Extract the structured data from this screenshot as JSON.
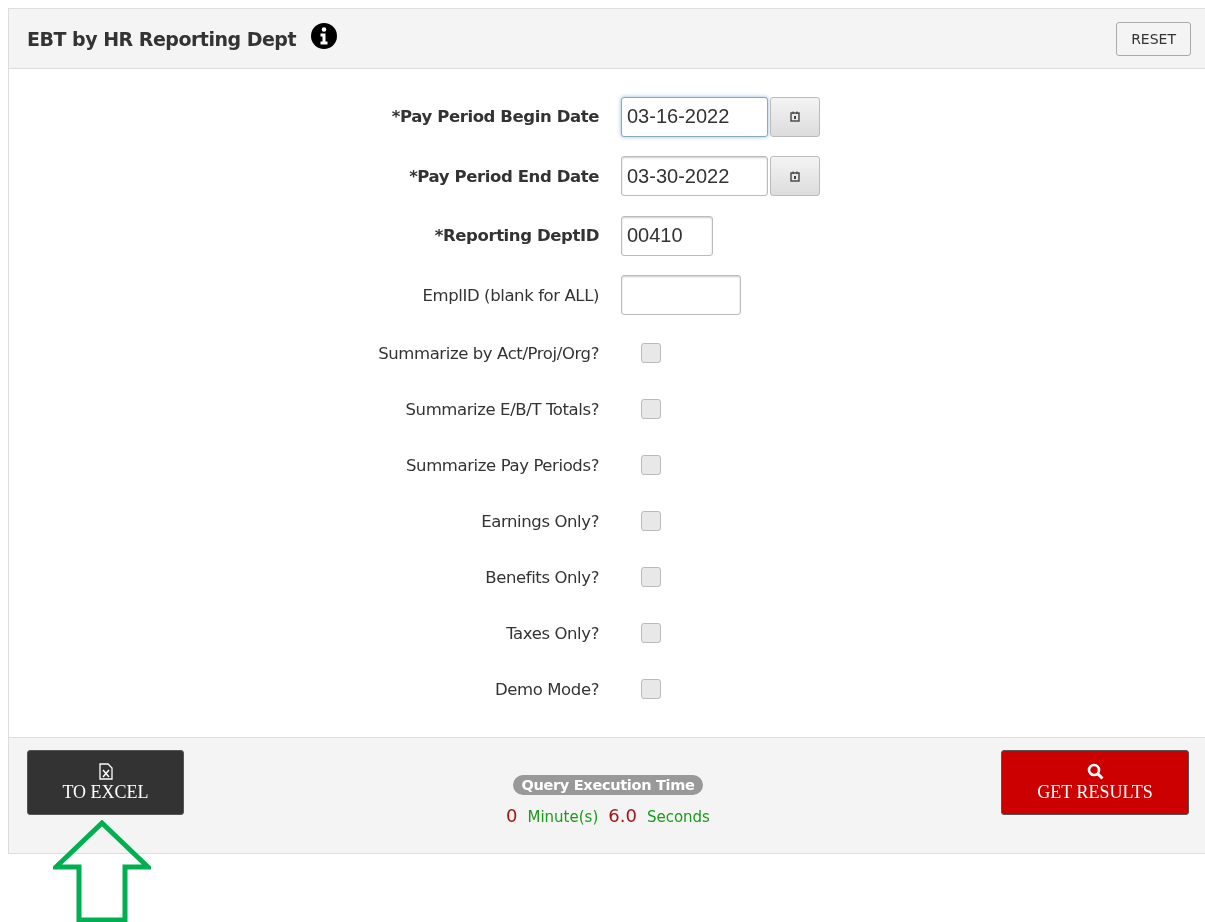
{
  "header": {
    "title": "EBT by HR Reporting Dept",
    "reset_button": "RESET"
  },
  "fields": [
    {
      "kind": "date",
      "label": "*Pay Period Begin Date",
      "required": true,
      "value": "03-16-2022",
      "focused": true
    },
    {
      "kind": "date",
      "label": "*Pay Period End Date",
      "required": true,
      "value": "03-30-2022",
      "focused": false
    },
    {
      "kind": "short_text",
      "label": "*Reporting DeptID",
      "required": true,
      "value": "00410"
    },
    {
      "kind": "text",
      "label": "EmplID (blank for ALL)",
      "required": false
    },
    {
      "kind": "checkbox",
      "label": "Summarize by Act/Proj/Org?",
      "checked": false
    },
    {
      "kind": "checkbox",
      "label": "Summarize E/B/T Totals?",
      "checked": false
    },
    {
      "kind": "checkbox",
      "label": "Summarize Pay Periods?",
      "checked": false
    },
    {
      "kind": "checkbox",
      "label": "Earnings Only?",
      "checked": false
    },
    {
      "kind": "checkbox",
      "label": "Benefits Only?",
      "checked": false
    },
    {
      "kind": "checkbox",
      "label": "Taxes Only?",
      "checked": false
    },
    {
      "kind": "checkbox",
      "label": "Demo Mode?",
      "checked": false
    }
  ],
  "footer": {
    "excel_button": "TO EXCEL",
    "timer_label": "Query Execution Time",
    "minutes": "0",
    "minutes_unit": "Minute(s)",
    "seconds": "6.0",
    "seconds_unit": "Seconds",
    "results_button": "GET RESULTS"
  },
  "annotation": {
    "kind": "arrow"
  }
}
